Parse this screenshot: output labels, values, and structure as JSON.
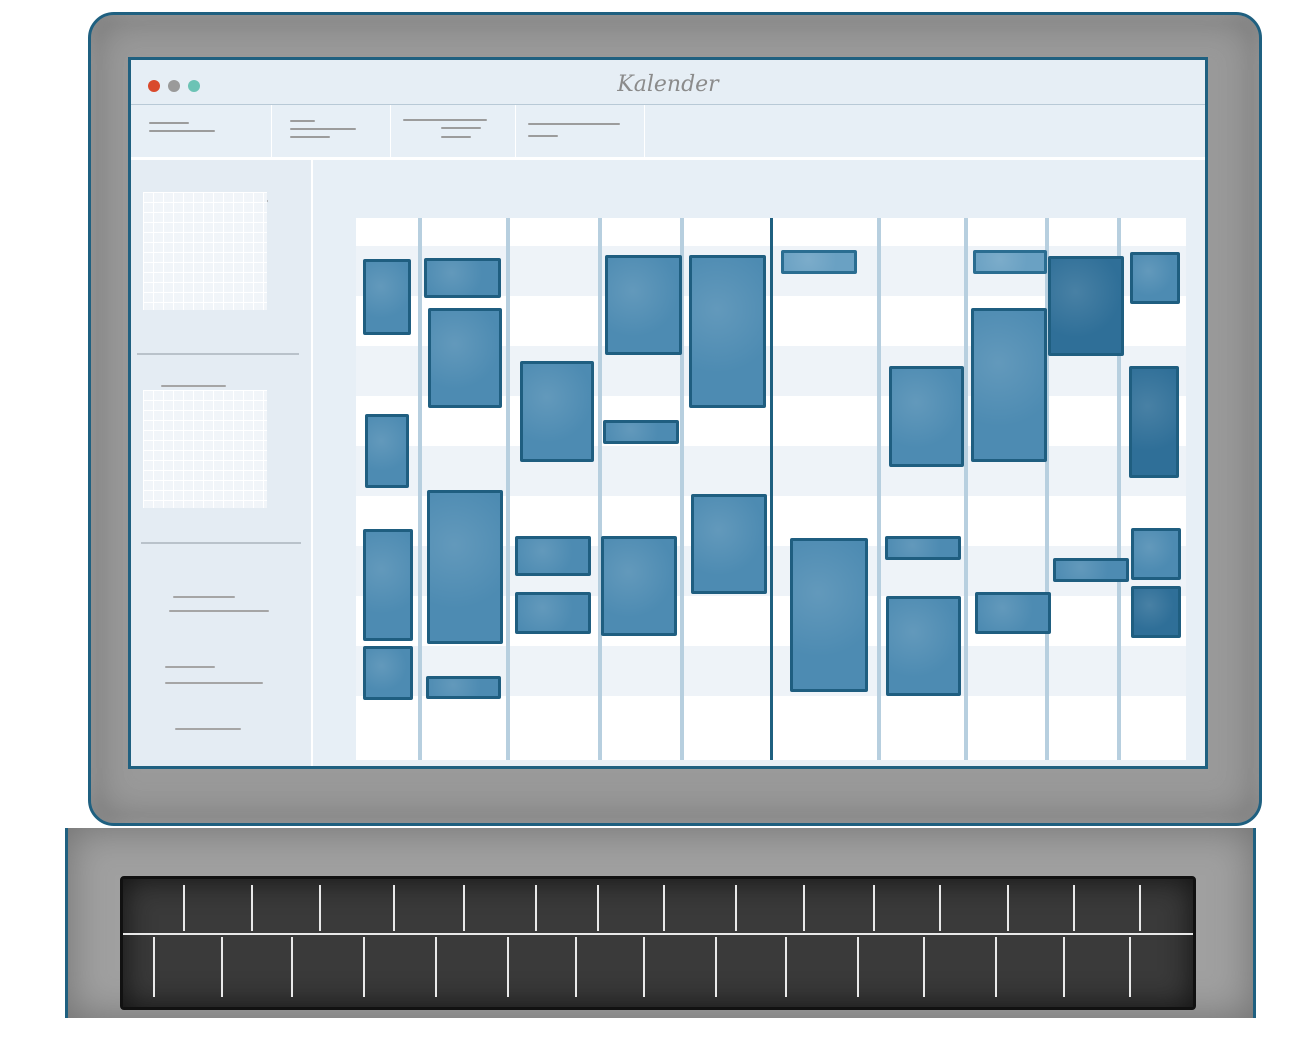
{
  "window": {
    "title": "Kalender",
    "traffic_lights": [
      "close",
      "minimize",
      "zoom"
    ]
  },
  "colors": {
    "event_fill": "#4d8bb2",
    "event_border": "#1f5e80",
    "frame": "#1f6080",
    "close": "#d94a2c",
    "minimize": "#9a9a9a",
    "zoom": "#6cc3b5"
  },
  "icons": [
    "close-button",
    "minimize-button",
    "zoom-button"
  ]
}
